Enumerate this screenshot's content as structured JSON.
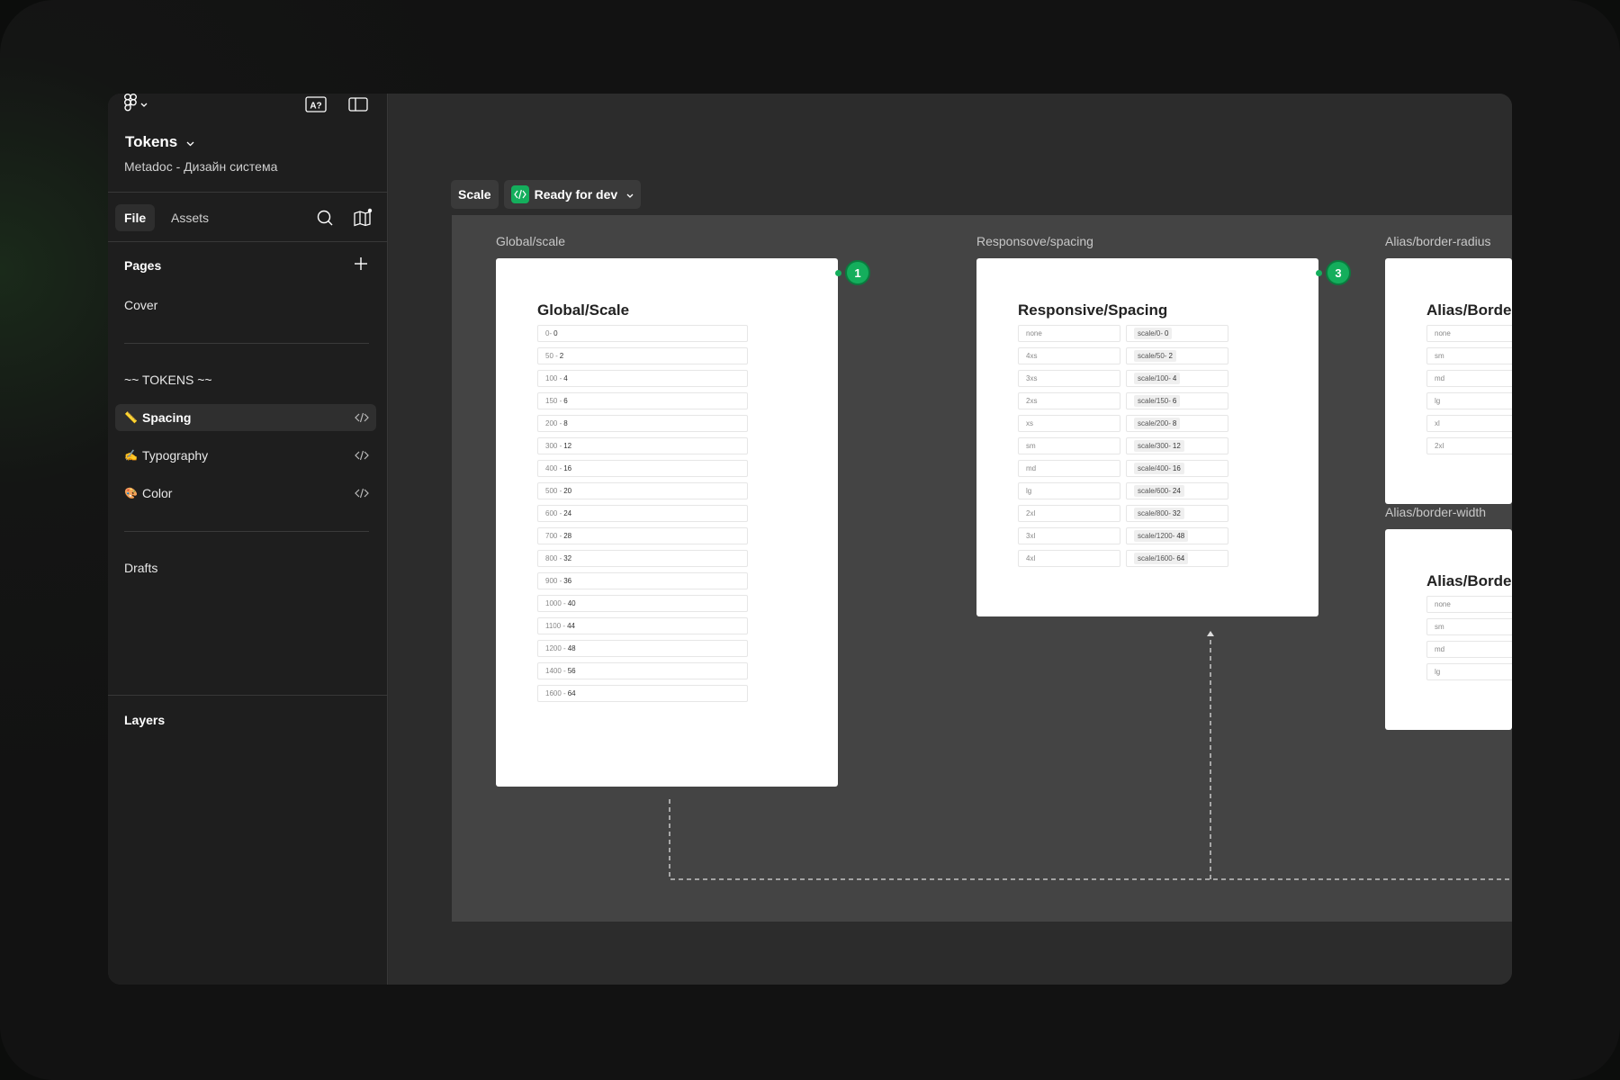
{
  "sidebar": {
    "file_title": "Tokens",
    "file_subtitle": "Metadoc - Дизайн система",
    "tabs": {
      "file": "File",
      "assets": "Assets"
    },
    "pages_title": "Pages",
    "pages": [
      {
        "label": "Cover"
      },
      {
        "label": "~~ TOKENS ~~"
      },
      {
        "emoji": "📏",
        "label": "Spacing",
        "selected": true
      },
      {
        "emoji": "✍️",
        "label": "Typography"
      },
      {
        "emoji": "🎨",
        "label": "Color"
      },
      {
        "label": "Drafts"
      }
    ],
    "layers_title": "Layers"
  },
  "canvas": {
    "section_name": "Scale",
    "status": "Ready for dev",
    "accent": "#14ae5c",
    "frames": [
      {
        "label": "Global/scale",
        "title": "Global/Scale",
        "badge": "1",
        "rows": [
          [
            "0-",
            "0"
          ],
          [
            "50 - ",
            "2"
          ],
          [
            "100 - ",
            "4"
          ],
          [
            "150 - ",
            "6"
          ],
          [
            "200 - ",
            "8"
          ],
          [
            "300 - ",
            "12"
          ],
          [
            "400 - ",
            "16"
          ],
          [
            "500 -",
            "20"
          ],
          [
            "600 - ",
            "24"
          ],
          [
            "700 - ",
            "28"
          ],
          [
            "800 -",
            "32"
          ],
          [
            "900 - ",
            "36"
          ],
          [
            "1000 -",
            "40"
          ],
          [
            "1100 -",
            "44"
          ],
          [
            "1200 - ",
            "48"
          ],
          [
            "1400 - ",
            "56"
          ],
          [
            "1600 - ",
            "64"
          ]
        ]
      },
      {
        "label": "Responsove/spacing",
        "title": "Responsive/Spacing",
        "badge": "3",
        "rows": [
          [
            "none",
            "scale/0-",
            "0"
          ],
          [
            "4xs",
            "scale/50-",
            "2"
          ],
          [
            "3xs",
            "scale/100-",
            "4"
          ],
          [
            "2xs",
            "scale/150-",
            "6"
          ],
          [
            "xs",
            "scale/200-",
            "8"
          ],
          [
            "sm",
            "scale/300-",
            "12"
          ],
          [
            "md",
            "scale/400-",
            "16"
          ],
          [
            "lg",
            "scale/600-",
            "24"
          ],
          [
            "2xl",
            "scale/800-",
            "32"
          ],
          [
            "3xl",
            "scale/1200-",
            "48"
          ],
          [
            "4xl",
            "scale/1600-",
            "64"
          ]
        ]
      },
      {
        "label": "Alias/border-radius",
        "title": "Alias/Borde",
        "rows": [
          "none",
          "sm",
          "md",
          "lg",
          "xl",
          "2xl"
        ]
      },
      {
        "label": "Alias/border-width",
        "title": "Alias/Borde",
        "rows": [
          "none",
          "sm",
          "md",
          "lg"
        ]
      }
    ]
  }
}
